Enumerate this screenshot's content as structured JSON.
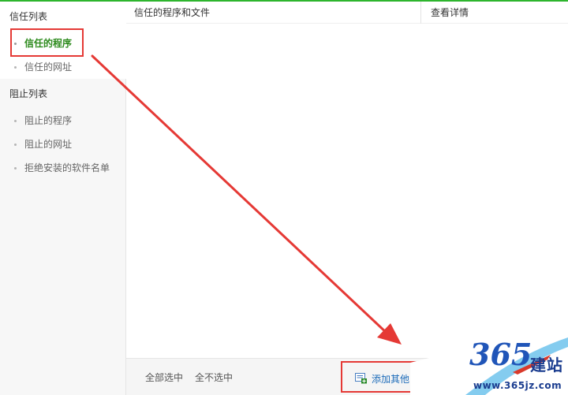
{
  "sidebar": {
    "trust_heading": "信任列表",
    "trust_items": [
      {
        "label": "信任的程序",
        "active": true
      },
      {
        "label": "信任的网址",
        "active": false
      }
    ],
    "block_heading": "阻止列表",
    "block_items": [
      {
        "label": "阻止的程序"
      },
      {
        "label": "阻止的网址"
      },
      {
        "label": "拒绝安装的软件名单"
      }
    ]
  },
  "table": {
    "col_programs": "信任的程序和文件",
    "col_details": "查看详情"
  },
  "footer": {
    "select_all": "全部选中",
    "select_none": "全不选中",
    "add_label": "添加其他"
  },
  "watermark": {
    "logo": "365",
    "brand": "建站",
    "url": "www.365jz.com"
  },
  "colors": {
    "accent_green": "#2db52d",
    "active_text": "#2c8a1c",
    "highlight_red": "#e53935",
    "link_blue": "#1c6bb9"
  }
}
